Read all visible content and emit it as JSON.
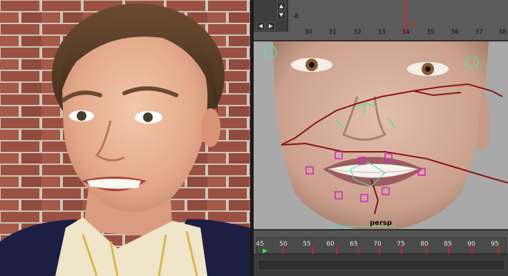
{
  "graph_editor": {
    "negative_value": "-8",
    "frame_numbers": [
      "30",
      "31",
      "32",
      "33",
      "34",
      "35",
      "36",
      "37",
      "38"
    ],
    "current_frame": "34"
  },
  "viewport": {
    "camera_label": "persp"
  },
  "time_slider": {
    "labels": [
      "45",
      "50",
      "55",
      "60",
      "65",
      "70",
      "75",
      "80",
      "85",
      "90",
      "95"
    ]
  },
  "colors": {
    "control_cyan": "#4ee4a0",
    "control_magenta": "#d020c8",
    "key_red": "#cc2222",
    "curve_red": "#8a1010"
  },
  "icons": [
    "up-arrow-icon",
    "down-arrow-icon",
    "left-arrow-icon",
    "right-arrow-icon"
  ]
}
